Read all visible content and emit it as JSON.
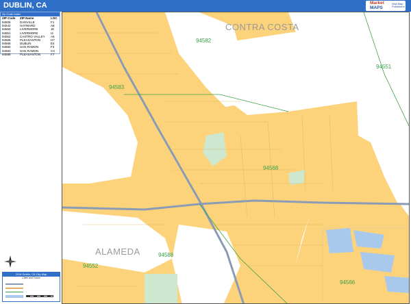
{
  "header": {
    "title": "DUBLIN, CA",
    "brand_line1": "Market",
    "brand_line2": "MAPS",
    "brand_small": "Wall Map Publishers"
  },
  "zip_index": {
    "heading": "Zip Code Index",
    "columns": [
      "ZIP Code",
      "ZIP Name",
      "LOC"
    ],
    "rows": [
      [
        "94506",
        "DANVILLE",
        "F1"
      ],
      [
        "94542",
        "HAYWARD",
        "A8"
      ],
      [
        "94550",
        "LIVERMORE",
        "J8"
      ],
      [
        "94551",
        "LIVERMORE",
        "I4"
      ],
      [
        "94552",
        "CASTRO VALLEY",
        "A5"
      ],
      [
        "94566",
        "PLEASANTON",
        "H7"
      ],
      [
        "94568",
        "DUBLIN",
        "E4"
      ],
      [
        "94582",
        "SAN RAMON",
        "F2"
      ],
      [
        "94583",
        "SAN RAMON",
        "C3"
      ],
      [
        "94588",
        "PLEASANTON",
        "F7"
      ]
    ]
  },
  "map": {
    "zip_labels": [
      "94582",
      "94551",
      "94583",
      "94568",
      "94588",
      "94552",
      "94566"
    ],
    "county_labels": [
      "CONTRA COSTA",
      "ALAMEDA"
    ],
    "colors": {
      "city_fill": "#fcd27a",
      "water": "#a9c9ec",
      "park": "#cde8cf",
      "highway": "#8a9bb5",
      "zip_boundary": "#3aa34a"
    }
  },
  "legend": {
    "title": "2016 Dublin, CA City Map",
    "subtitle": "Cities and Towns"
  },
  "compass": {
    "north_label": "N"
  }
}
